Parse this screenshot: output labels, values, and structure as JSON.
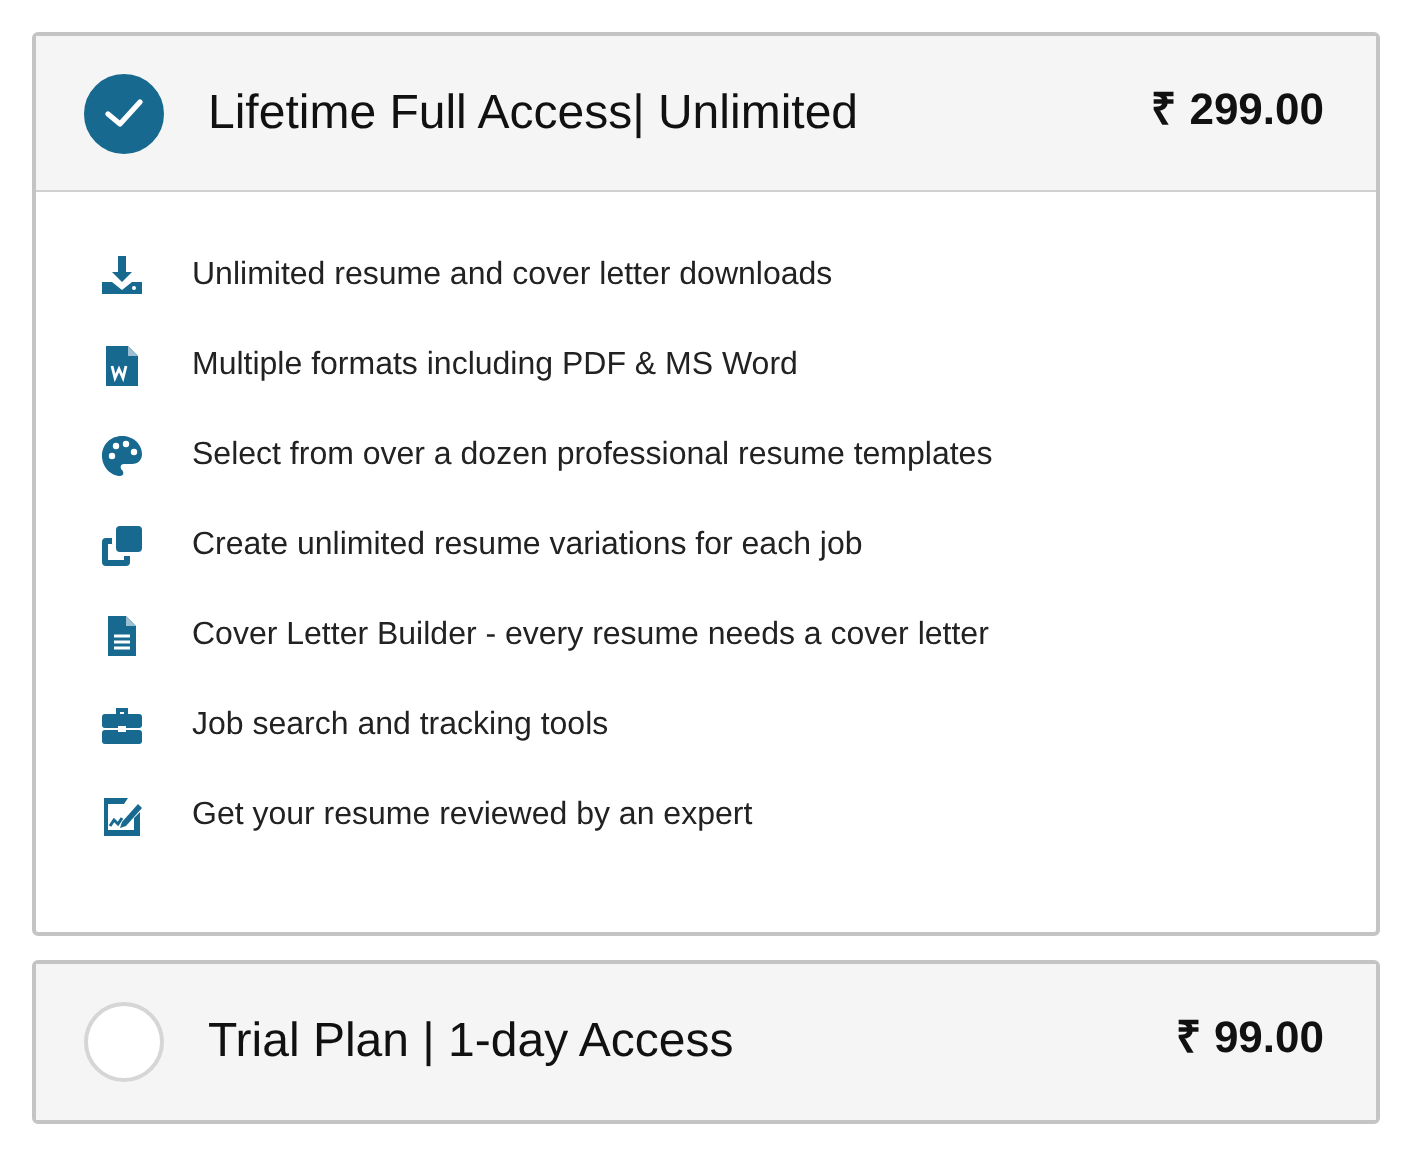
{
  "plans": [
    {
      "title": "Lifetime Full Access| Unlimited",
      "price": "₹ 299.00",
      "selected": true,
      "features": [
        "Unlimited resume and cover letter downloads",
        "Multiple formats including PDF & MS Word",
        "Select from over a dozen professional resume templates",
        "Create unlimited resume variations for each job",
        "Cover Letter Builder - every resume needs a cover letter",
        "Job search and tracking tools",
        "Get your resume reviewed by an expert"
      ]
    },
    {
      "title": "Trial Plan | 1-day Access",
      "price": "₹ 99.00",
      "selected": false
    }
  ]
}
